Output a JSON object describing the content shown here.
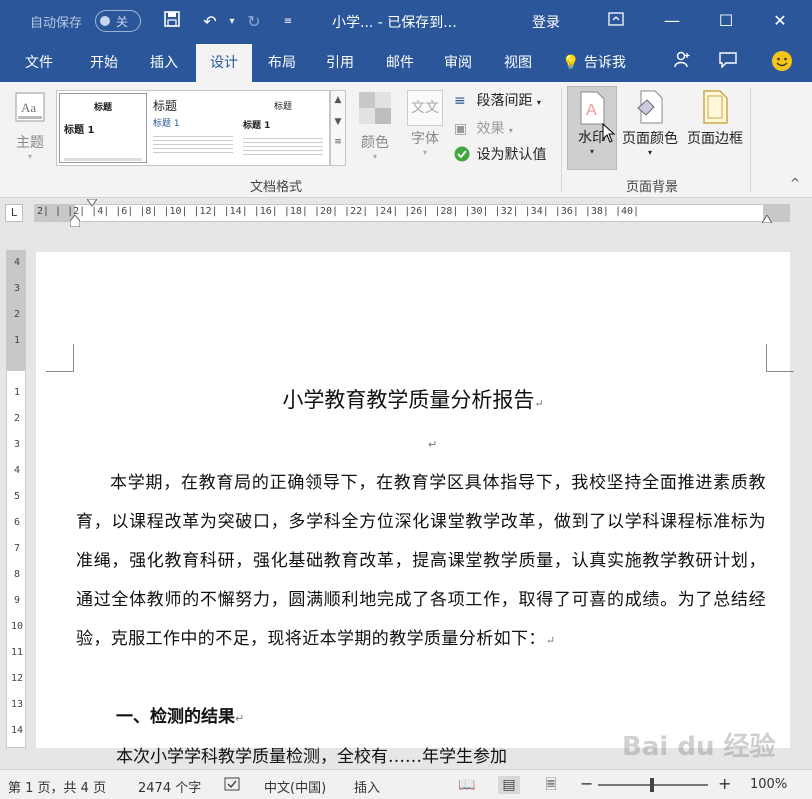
{
  "titlebar": {
    "autosave_label": "自动保存",
    "autosave_state": "关",
    "doc_title": "小学...  -  已保存到...",
    "login_label": "登录"
  },
  "tabs": [
    "文件",
    "开始",
    "插入",
    "设计",
    "布局",
    "引用",
    "邮件",
    "审阅",
    "视图"
  ],
  "active_tab": "设计",
  "tell_me": "告诉我",
  "ribbon": {
    "theme_label": "主题",
    "styleset": {
      "thumb1_title": "标题",
      "thumb1_heading": "标题 1",
      "thumb2_title": "标题",
      "thumb2_heading": "标题 1",
      "thumb3_title": "标题",
      "thumb3_heading": "标题 1"
    },
    "colors_label": "颜色",
    "fonts_label": "字体",
    "fonts_glyph": "文文",
    "paragraph_spacing_label": "段落间距",
    "effects_label": "效果",
    "set_default_label": "设为默认值",
    "group_doc_format": "文档格式",
    "watermark_label": "水印",
    "page_color_label": "页面颜色",
    "page_border_label": "页面边框",
    "group_page_bg": "页面背景"
  },
  "ruler": {
    "corner": "L",
    "horizontal_ticks": "2| |  |2| |4| |6| |8| |10| |12| |14| |16| |18| |20| |22| |24| |26| |28| |30| |32| |34| |36| |38| |40|",
    "vertical_ticks": [
      "4",
      "3",
      "2",
      "1",
      "",
      "1",
      "2",
      "3",
      "4",
      "5",
      "6",
      "7",
      "8",
      "9",
      "10",
      "11",
      "12",
      "13",
      "14"
    ]
  },
  "document": {
    "title": "小学教育教学质量分析报告",
    "paragraph": "本学期，在教育局的正确领导下，在教育学区具体指导下，我校坚持全面推进素质教育，以课程改革为突破口，多学科全方位深化课堂教学改革，做到了以学科课程标准标为准绳，强化教育科研，强化基础教育改革，提高课堂教学质量，认真实施教学教研计划，通过全体教师的不懈努力，圆满顺利地完成了各项工作，取得了可喜的成绩。为了总结经验，克服工作中的不足，现将近本学期的教学质量分析如下：",
    "section1": "一、检测的结果",
    "cut_line": "本次小学学科教学质量检测，全校有……年学生参加",
    "para_mark": "↵"
  },
  "status": {
    "page_info": "第 1 页，共 4 页",
    "word_count": "2474 个字",
    "language": "中文(中国)",
    "mode": "插入",
    "zoom_minus": "−",
    "zoom_plus": "+",
    "zoom_level": "100%"
  },
  "watermark_text": "Bai du 经验"
}
